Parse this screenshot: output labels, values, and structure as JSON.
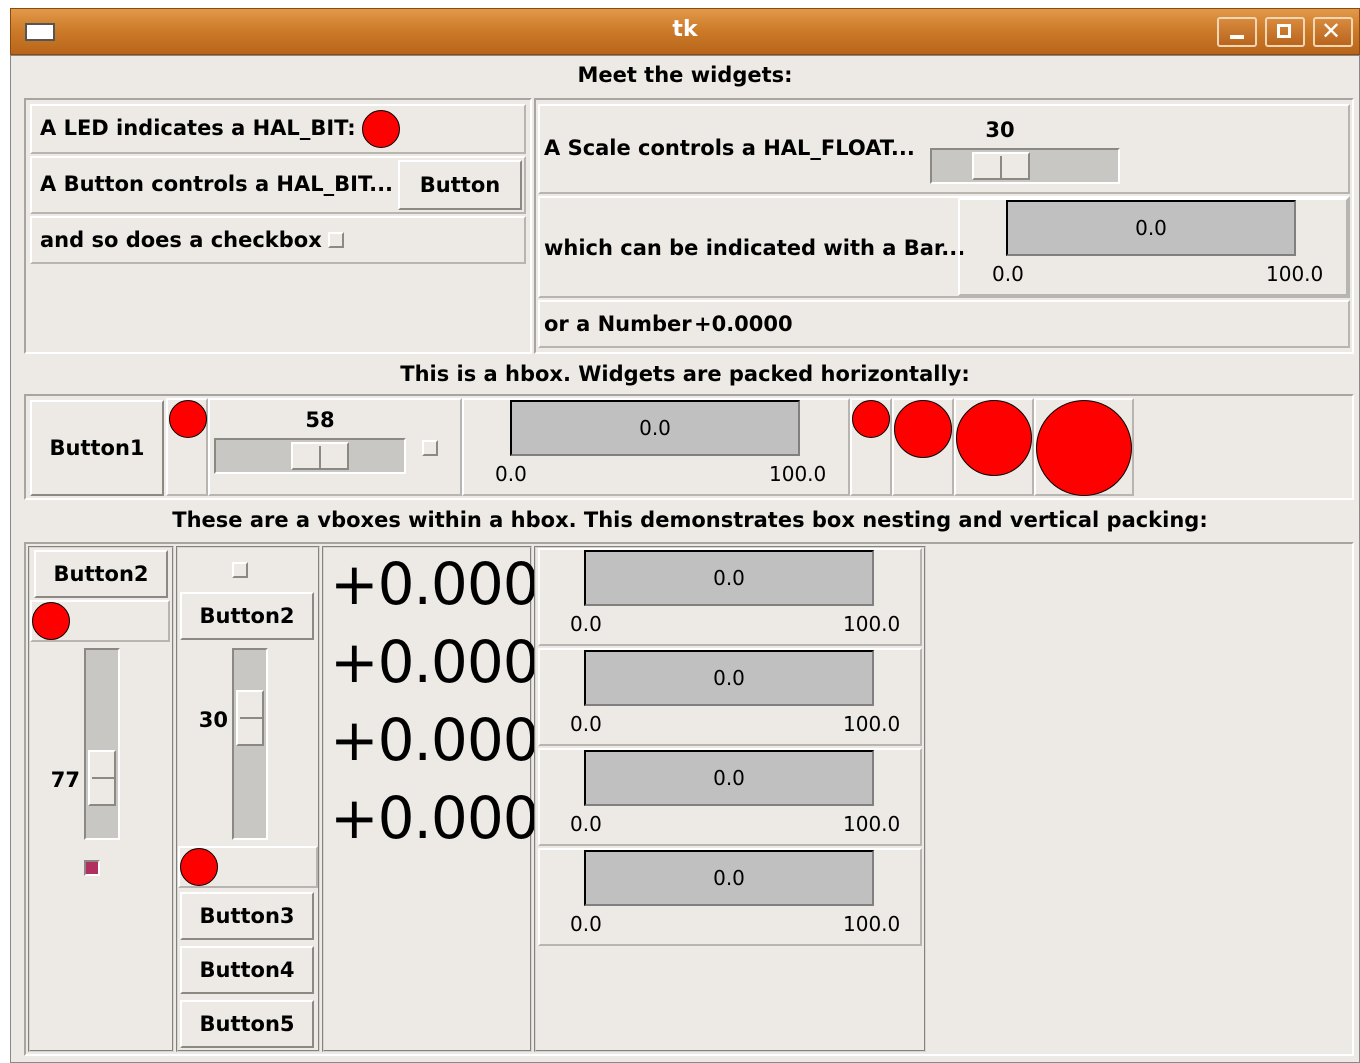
{
  "window": {
    "title": "tk"
  },
  "heading": "Meet the widgets:",
  "top_left": {
    "led_label": "A LED indicates a HAL_BIT:",
    "button_label": "A Button controls a HAL_BIT...",
    "button_text": "Button",
    "checkbox_label": "and so does a checkbox"
  },
  "top_right": {
    "scale_label": "A Scale controls a HAL_FLOAT...",
    "scale_value": "30",
    "bar_label": "which can be indicated with a Bar...",
    "bar": {
      "value": "0.0",
      "min": "0.0",
      "max": "100.0"
    },
    "number_label": "or a Number",
    "number_value": "+0.0000"
  },
  "hbox": {
    "heading": "This is a hbox. Widgets are packed horizontally:",
    "button_text": "Button1",
    "scale_value": "58",
    "bar": {
      "value": "0.0",
      "min": "0.0",
      "max": "100.0"
    }
  },
  "vbox": {
    "heading": "These are a vboxes within a hbox. This demonstrates box nesting and vertical packing:",
    "col1": {
      "button_text": "Button2",
      "scale_value": "77"
    },
    "col2": {
      "button_text": "Button2",
      "scale_value": "30",
      "buttons": [
        "Button3",
        "Button4",
        "Button5"
      ]
    },
    "numbers": [
      "+0.000",
      "+0.000",
      "+0.000",
      "+0.000"
    ],
    "bars": [
      {
        "value": "0.0",
        "min": "0.0",
        "max": "100.0"
      },
      {
        "value": "0.0",
        "min": "0.0",
        "max": "100.0"
      },
      {
        "value": "0.0",
        "min": "0.0",
        "max": "100.0"
      },
      {
        "value": "0.0",
        "min": "0.0",
        "max": "100.0"
      }
    ]
  },
  "colors": {
    "led_on": "#ff0000",
    "title_bar": "#cd7c2a",
    "background": "#edeae5",
    "bar_fill": "#c0c0c0"
  }
}
